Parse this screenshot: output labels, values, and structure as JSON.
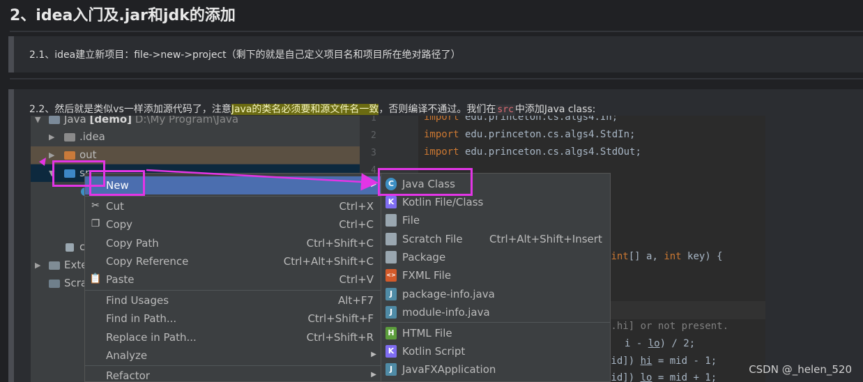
{
  "article": {
    "heading": "2、idea入门及.jar和jdk的添加",
    "step1": "2.1、idea建立新项目：file->new->project（剩下的就是自己定义项目名和项目所在绝对路径了）",
    "step2": {
      "before": "2.2、然后就是类似vs一样添加源代码了，注意",
      "highlight": "Java的类名必须要和源文件名一致",
      "middle": "，否则编译不通过。我们在",
      "code": "src",
      "after": "中添加Java class:"
    }
  },
  "project_tree": {
    "root_name": "Java",
    "root_module": "[demo]",
    "root_path": "D:\\My Program\\Java",
    "items": [
      {
        "label": ".idea"
      },
      {
        "label": "out"
      },
      {
        "label": "src"
      }
    ],
    "partial_labels": [
      "c",
      "Exte",
      "Scra"
    ]
  },
  "editor": {
    "line_numbers": [
      "1",
      "2",
      "3",
      "4"
    ],
    "lines": [
      {
        "kw": "import",
        "rest": " edu.princeton.cs.algs4.In;"
      },
      {
        "kw": "import",
        "rest": " edu.princeton.cs.algs4.StdIn;"
      },
      {
        "kw": "import",
        "rest": " edu.princeton.cs.algs4.StdOut;"
      }
    ],
    "brace": "}",
    "method_sig": {
      "p1": "(",
      "k1": "int",
      "p2": "[] a, ",
      "k2": "int",
      "p3": " key) {"
    },
    "semi": ";",
    "comment": "..hi] or not present.",
    "expr1": {
      "a": "i - ",
      "u": "lo",
      "b": ") / 2;"
    },
    "expr2": {
      "a": "mid]) ",
      "u": "hi",
      "b": " = mid - 1;"
    },
    "expr3": {
      "a": "mid]) ",
      "u": "lo",
      "b": " = mid + 1;"
    }
  },
  "context_menu": {
    "new": {
      "label": "New"
    },
    "items": [
      {
        "label": "Cut",
        "shortcut": "Ctrl+X",
        "icon": "scissors-icon"
      },
      {
        "label": "Copy",
        "shortcut": "Ctrl+C",
        "icon": "copy-icon"
      },
      {
        "label": "Copy Path",
        "shortcut": "Ctrl+Shift+C"
      },
      {
        "label": "Copy Reference",
        "shortcut": "Ctrl+Alt+Shift+C"
      },
      {
        "label": "Paste",
        "shortcut": "Ctrl+V",
        "icon": "clipboard-icon"
      },
      {
        "label": "Find Usages",
        "shortcut": "Alt+F7"
      },
      {
        "label": "Find in Path...",
        "shortcut": "Ctrl+Shift+F"
      },
      {
        "label": "Replace in Path...",
        "shortcut": "Ctrl+Shift+R"
      },
      {
        "label": "Analyze",
        "shortcut": ""
      },
      {
        "label": "Refactor",
        "shortcut": ""
      }
    ]
  },
  "new_submenu": {
    "items": [
      {
        "label": "Java Class",
        "shortcut": "",
        "icon": "java-class-icon",
        "icon_text": "C",
        "color": "#3d8fc4"
      },
      {
        "label": "Kotlin File/Class",
        "shortcut": "",
        "icon": "kotlin-icon",
        "icon_text": "K",
        "color": "#7f6df2"
      },
      {
        "label": "File",
        "shortcut": "",
        "icon": "file-icon",
        "icon_text": "",
        "color": "#9aa7b0"
      },
      {
        "label": "Scratch File",
        "shortcut": "Ctrl+Alt+Shift+Insert",
        "icon": "scratch-file-icon",
        "icon_text": "",
        "color": "#9aa7b0"
      },
      {
        "label": "Package",
        "shortcut": "",
        "icon": "package-icon",
        "icon_text": "",
        "color": "#9aa7b0"
      },
      {
        "label": "FXML File",
        "shortcut": "",
        "icon": "fxml-icon",
        "icon_text": "<>",
        "color": "#d45a2a"
      },
      {
        "label": "package-info.java",
        "shortcut": "",
        "icon": "java-file-icon",
        "icon_text": "J",
        "color": "#4f8ba6"
      },
      {
        "label": "module-info.java",
        "shortcut": "",
        "icon": "java-file-icon",
        "icon_text": "J",
        "color": "#4f8ba6"
      },
      {
        "label": "HTML File",
        "shortcut": "",
        "icon": "html-icon",
        "icon_text": "H",
        "color": "#5c9e3c"
      },
      {
        "label": "Kotlin Script",
        "shortcut": "",
        "icon": "kotlin-icon",
        "icon_text": "K",
        "color": "#7f6df2"
      },
      {
        "label": "JavaFXApplication",
        "shortcut": "",
        "icon": "java-file-icon",
        "icon_text": "J",
        "color": "#4f8ba6"
      }
    ]
  },
  "watermark": "CSDN @_helen_520",
  "colors": {
    "annotation": "#e335e6",
    "selection": "#4b6eaf"
  }
}
